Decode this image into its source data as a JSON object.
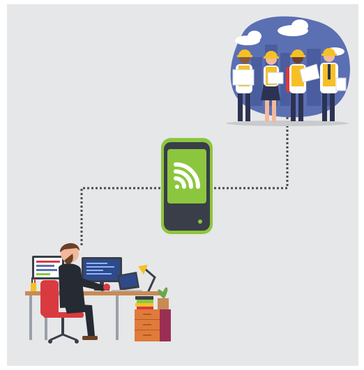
{
  "diagram": {
    "nodes": [
      {
        "id": "office-worker",
        "icon": "developer-at-desk-icon"
      },
      {
        "id": "nfc-device",
        "icon": "nfc-signal-icon"
      },
      {
        "id": "construction-crew",
        "icon": "construction-team-icon"
      }
    ],
    "edges": [
      {
        "from": "office-worker",
        "to": "nfc-device",
        "style": "dotted"
      },
      {
        "from": "nfc-device",
        "to": "construction-crew",
        "style": "dotted"
      }
    ]
  },
  "colors": {
    "background": "#e6e7e8",
    "device_shell": "#8cc63f",
    "device_body": "#3a3e48",
    "screen": "#8cc63f",
    "blob": "#5b6fb3",
    "hard_hat": "#f6c025",
    "chair": "#d93a3f",
    "connector": "#4a4a55"
  }
}
